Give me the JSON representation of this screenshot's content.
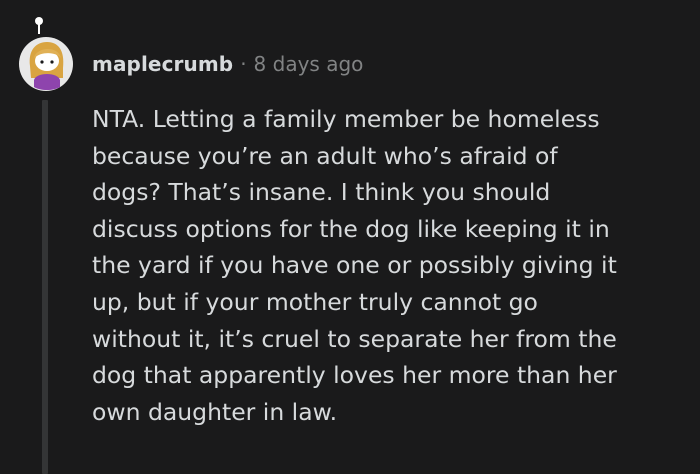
{
  "comment": {
    "author": "maplecrumb",
    "separator": "·",
    "timestamp": "8 days ago",
    "avatar_icon": "snoo-avatar-icon",
    "body_lines": [
      "NTA. Letting a family member be homeless",
      "because you’re an adult who’s afraid of",
      "dogs? That’s insane. I think you should",
      "discuss options for the dog like keeping it in",
      "the yard if you have one or possibly giving it",
      "up, but if your mother truly cannot go",
      "without it, it’s cruel to separate her from the",
      "dog that apparently loves her more than her",
      "own daughter in law."
    ]
  },
  "colors": {
    "background": "#1a1a1b",
    "text": "#d7dadc",
    "meta": "#818384",
    "thread_line": "#343536",
    "avatar_bg": "#e8e8e8",
    "avatar_hair": "#d9a441",
    "avatar_shirt": "#8e44ad"
  }
}
